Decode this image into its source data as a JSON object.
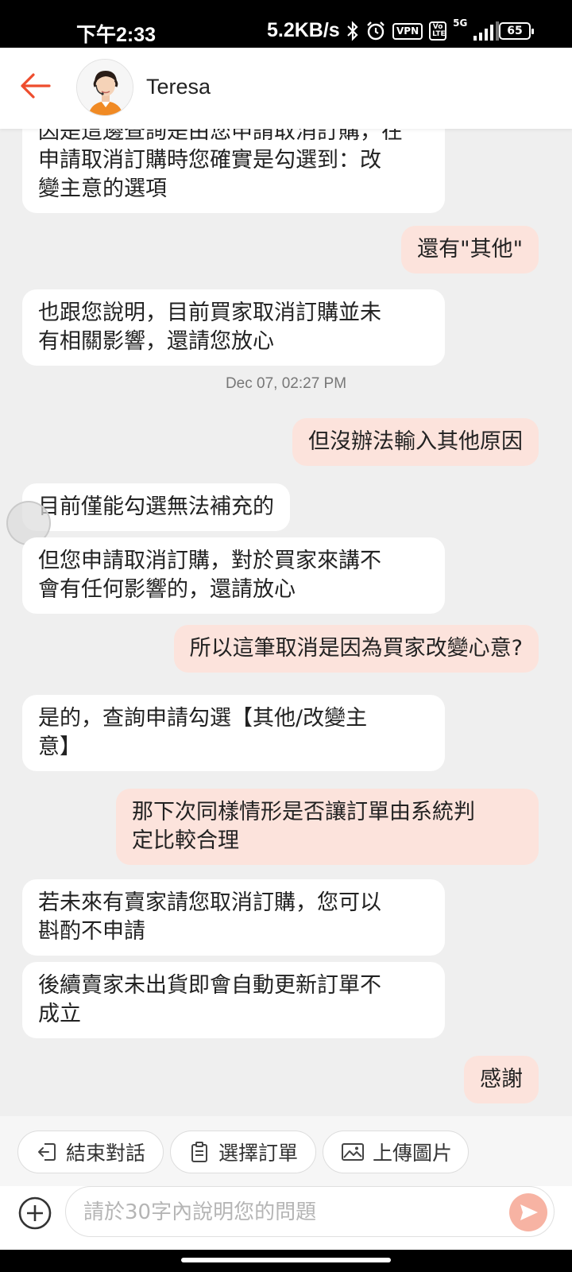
{
  "status_bar": {
    "time": "下午2:33",
    "net_speed": "5.2KB/s",
    "vpn_label": "VPN",
    "volte_label": "Vo LTE",
    "network_label": "5G",
    "battery": "65",
    "icons": [
      "bluetooth-icon",
      "alarm-icon",
      "signal-icon"
    ]
  },
  "header": {
    "agent_name": "Teresa",
    "back_icon": "back-arrow-icon",
    "accent_color": "#ee4d2d"
  },
  "messages": [
    {
      "side": "in",
      "text": "因是這邊查詢是由您申請取消訂購，在\n申請取消訂購時您確實是勾選到：改\n變主意的選項"
    },
    {
      "side": "out",
      "text": "還有\"其他\""
    },
    {
      "side": "in",
      "text": "也跟您說明，目前買家取消訂購並未\n有相關影響，還請您放心"
    },
    {
      "side": "out",
      "text": "但沒辦法輸入其他原因"
    },
    {
      "side": "in",
      "text": "目前僅能勾選無法補充的"
    },
    {
      "side": "in",
      "text": "但您申請取消訂購，對於買家來講不\n會有任何影響的，還請放心"
    },
    {
      "side": "out",
      "text": "所以這筆取消是因為買家改變心意?"
    },
    {
      "side": "in",
      "text": "是的，查詢申請勾選【其他/改變主\n意】"
    },
    {
      "side": "out",
      "text": "那下次同樣情形是否讓訂單由系統判\n定比較合理"
    },
    {
      "side": "in",
      "text": "若未來有賣家請您取消訂購，您可以\n斟酌不申請"
    },
    {
      "side": "in",
      "text": "後續賣家未出貨即會自動更新訂單不\n成立"
    },
    {
      "side": "out",
      "text": "感謝"
    }
  ],
  "timestamp": "Dec 07, 02:27 PM",
  "quick_actions": [
    {
      "label": "結束對話",
      "icon": "exit-chat-icon"
    },
    {
      "label": "選擇訂單",
      "icon": "clipboard-icon"
    },
    {
      "label": "上傳圖片",
      "icon": "image-icon"
    }
  ],
  "input": {
    "placeholder": "請於30字內說明您的問題",
    "value": ""
  },
  "colors": {
    "incoming_bubble": "#ffffff",
    "outgoing_bubble": "#fce3dc",
    "background": "#efefef",
    "send_button": "#f7b3a3"
  }
}
